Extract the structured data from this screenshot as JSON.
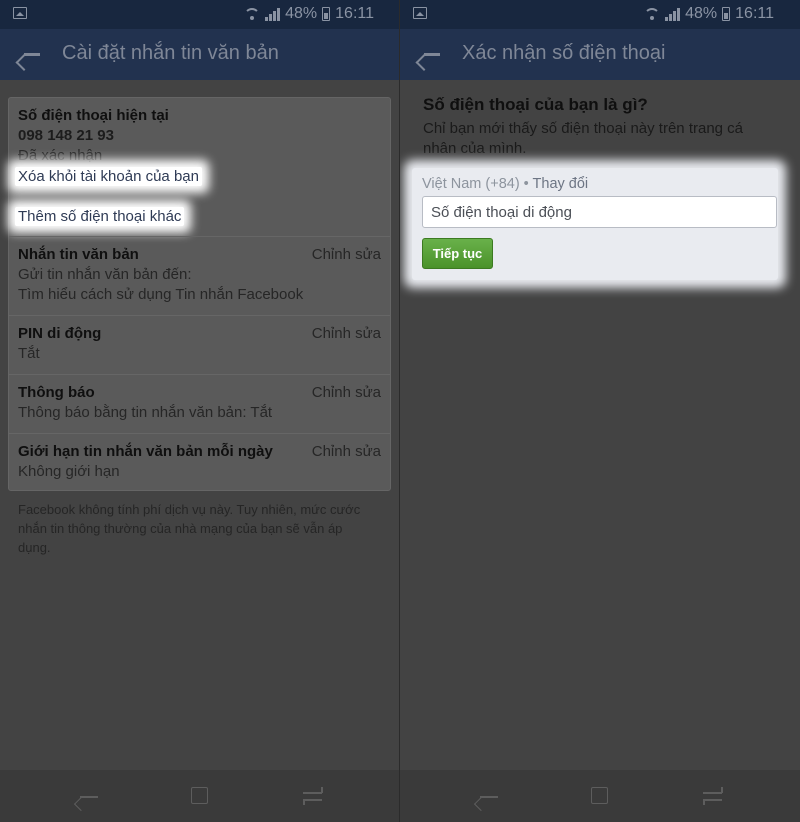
{
  "status_bar": {
    "battery": "48%",
    "time": "16:11"
  },
  "left": {
    "title": "Cài đặt nhắn tin văn bản",
    "current_phone": {
      "label": "Số điện thoại hiện tại",
      "number": "098 148 21 93",
      "status": "Đã xác nhận",
      "remove_link": "Xóa khỏi tài khoản của bạn",
      "add_link": "Thêm số điện thoại khác"
    },
    "sections": [
      {
        "title": "Nhắn tin văn bản",
        "lines": [
          "Gửi tin nhắn văn bản đến:",
          "Tìm hiểu cách sử dụng Tin nhắn Facebook"
        ],
        "edit": "Chỉnh sửa"
      },
      {
        "title": "PIN di động",
        "lines": [
          "Tắt"
        ],
        "edit": "Chỉnh sửa"
      },
      {
        "title": "Thông báo",
        "lines": [
          "Thông báo bằng tin nhắn văn bản: Tắt"
        ],
        "edit": "Chỉnh sửa"
      },
      {
        "title": "Giới hạn tin nhắn văn bản mỗi ngày",
        "lines": [
          "Không giới hạn"
        ],
        "edit": "Chỉnh sửa"
      }
    ],
    "footnote": "Facebook không tính phí dịch vụ này. Tuy nhiên, mức cước nhắn tin thông thường của nhà mạng của bạn sẽ vẫn áp dụng."
  },
  "right": {
    "title": "Xác nhận số điện thoại",
    "question": "Số điện thoại của bạn là gì?",
    "subtitle": "Chỉ bạn mới thấy số điện thoại này trên trang cá nhân của mình.",
    "country": "Việt Nam (+84)",
    "separator": " • ",
    "change_link": "Thay đổi",
    "phone_placeholder": "Số điện thoại di động",
    "continue_label": "Tiếp tục"
  }
}
